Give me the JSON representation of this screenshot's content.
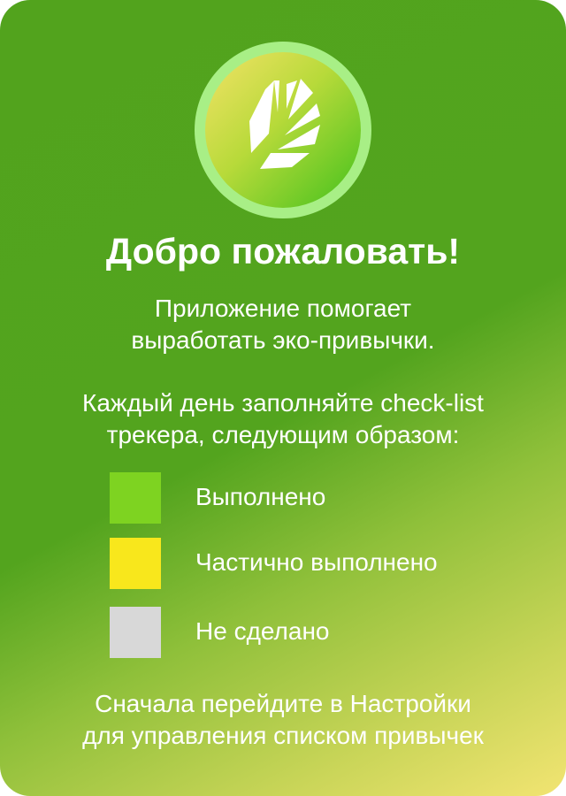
{
  "welcome": {
    "title": "Добро пожаловать!",
    "intro_line1": "Приложение помогает",
    "intro_line2": "выработать эко-привычки.",
    "instruction_line1": "Каждый день заполняйте check-list",
    "instruction_line2": "трекера, следующим образом:",
    "footer_line1": "Сначала перейдите в Настройки",
    "footer_line2": "для управления списком привычек"
  },
  "legend": [
    {
      "label": "Выполнено",
      "color": "#7ed321"
    },
    {
      "label": "Частично выполнено",
      "color": "#f8e71c"
    },
    {
      "label": "Не сделано",
      "color": "#d8d8d8"
    }
  ],
  "logo": {
    "icon": "leaf-icon"
  },
  "colors": {
    "background_green": "#53a41e",
    "background_yellow": "#f2e472",
    "logo_ring": "#a8ef86"
  }
}
